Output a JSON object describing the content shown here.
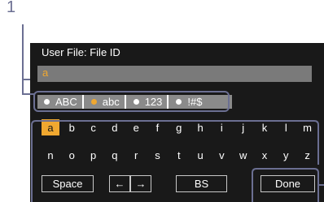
{
  "callout": {
    "number": "1"
  },
  "screen": {
    "title": "User File: File ID",
    "input_value": "a",
    "modes": [
      {
        "label": "ABC",
        "active": false
      },
      {
        "label": "abc",
        "active": true
      },
      {
        "label": "123",
        "active": false
      },
      {
        "label": "!#$",
        "active": false
      }
    ],
    "keyboard": {
      "row1": [
        "a",
        "b",
        "c",
        "d",
        "e",
        "f",
        "g",
        "h",
        "i",
        "j",
        "k",
        "l",
        "m"
      ],
      "row2": [
        "n",
        "o",
        "p",
        "q",
        "r",
        "s",
        "t",
        "u",
        "v",
        "w",
        "x",
        "y",
        "z"
      ],
      "selected_key": "a"
    },
    "buttons": {
      "space": "Space",
      "left": "←",
      "right": "→",
      "bs": "BS",
      "done": "Done"
    }
  },
  "colors": {
    "background": "#191919",
    "accent": "#f0a830",
    "input_bg": "#7a7a7a",
    "mode_bar_bg": "#8a8a8a",
    "callout_line": "#6b6f92"
  }
}
